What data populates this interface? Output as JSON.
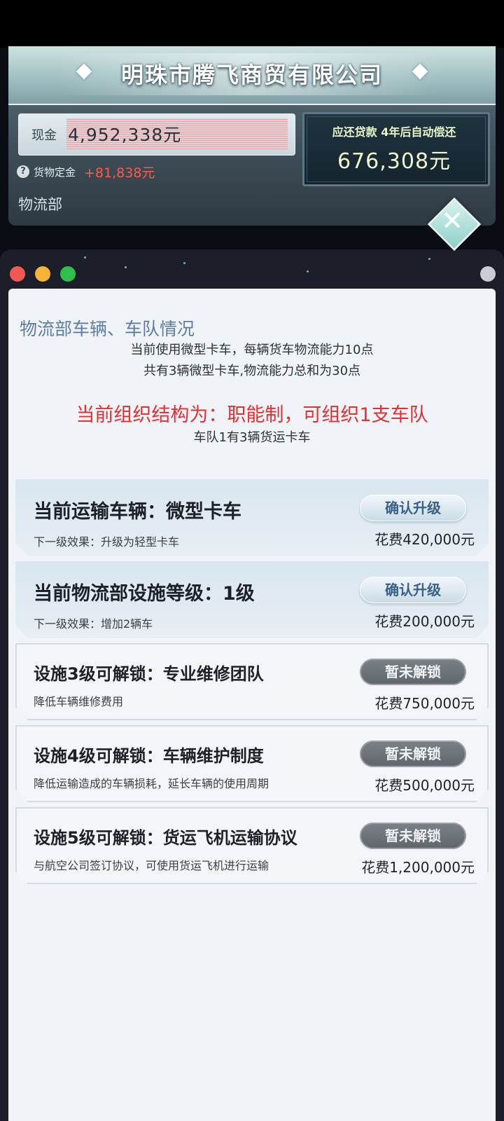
{
  "header": {
    "company_name": "明珠市腾飞商贸有限公司",
    "cash_label": "现金",
    "cash_value": "4,952,338元",
    "deposit_label": "货物定金",
    "deposit_value": "+81,838元",
    "loan_title": "应还贷款 4年后自动偿还",
    "loan_value": "676,308元",
    "department": "物流部",
    "colors": {
      "deposit_positive": "#ff5a4b",
      "loan_text": "#f2f7cc"
    }
  },
  "window": {
    "section_title": "物流部车辆、车队情况",
    "info_line_1": "当前使用微型卡车，每辆货车物流能力10点",
    "info_line_2": "共有3辆微型卡车,物流能力总和为30点",
    "structure_line": "当前组织结构为：职能制，可组织1支车队",
    "fleet_line": "车队1有3辆货运卡车",
    "cards": [
      {
        "title": "当前运输车辆：微型卡车",
        "desc": "下一级效果：升级为轻型卡车",
        "button": "确认升级",
        "cost": "花费420,000元",
        "state": "upgrade"
      },
      {
        "title": "当前物流部设施等级：1级",
        "desc": "下一级效果：增加2辆车",
        "button": "确认升级",
        "cost": "花费200,000元",
        "state": "upgrade"
      },
      {
        "title": "设施3级可解锁：专业维修团队",
        "desc": "降低车辆维修费用",
        "button": "暂未解锁",
        "cost": "花费750,000元",
        "state": "locked"
      },
      {
        "title": "设施4级可解锁：车辆维护制度",
        "desc": "降低运输造成的车辆损耗，延长车辆的使用周期",
        "button": "暂未解锁",
        "cost": "花费500,000元",
        "state": "locked"
      },
      {
        "title": "设施5级可解锁：货运飞机运输协议",
        "desc": "与航空公司签订协议，可使用货运飞机进行运输",
        "button": "暂未解锁",
        "cost": "花费1,200,000元",
        "state": "locked"
      }
    ],
    "colors": {
      "structure_text": "#e33131",
      "title_text": "#5d7ea0"
    }
  },
  "icons": [
    "help-icon",
    "close-icon",
    "window-dot-red",
    "window-dot-yellow",
    "window-dot-green"
  ]
}
